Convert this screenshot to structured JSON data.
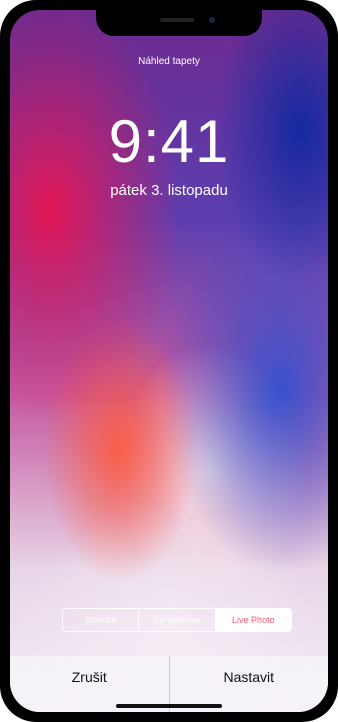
{
  "header": {
    "title": "Náhled tapety"
  },
  "lockscreen": {
    "time": "9:41",
    "date": "pátek 3. listopadu"
  },
  "segmented_control": {
    "options": [
      "Statické",
      "Perspektiva",
      "Live Photo"
    ],
    "selected": "Live Photo"
  },
  "actions": {
    "cancel_label": "Zrušit",
    "set_label": "Nastavit"
  },
  "colors": {
    "accent_selected_text": "#ff5a6e"
  }
}
